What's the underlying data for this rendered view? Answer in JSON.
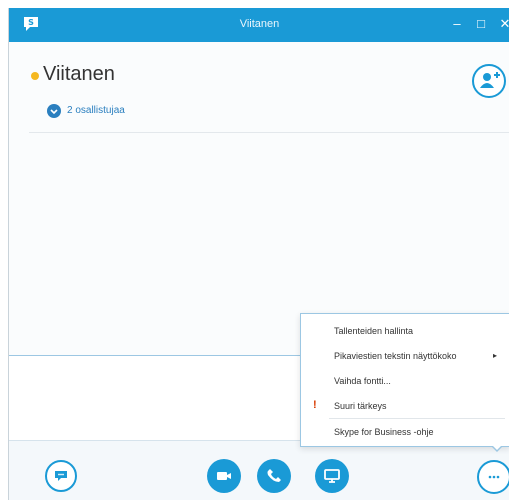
{
  "window": {
    "title": "Viitanen",
    "minimize_glyph": "–",
    "maximize_glyph": "□",
    "close_glyph": "✕"
  },
  "conversation": {
    "name": "Viitanen",
    "presence_color": "#f5b820",
    "participants_label": "2 osallistujaa"
  },
  "menu": {
    "items": [
      {
        "label": "Tallenteiden hallinta"
      },
      {
        "label": "Pikaviestien tekstin näyttökoko",
        "submenu_arrow": "▸"
      },
      {
        "label": "Vaihda fontti..."
      },
      {
        "label": "Suuri tärkeys",
        "icon_glyph": "!"
      },
      {
        "label": "Skype for Business -ohje"
      }
    ]
  },
  "toolbar": {
    "buttons": [
      {
        "icon": "chat-bubble-icon"
      },
      {
        "icon": "video-camera-icon"
      },
      {
        "icon": "phone-icon"
      },
      {
        "icon": "monitor-icon"
      },
      {
        "icon": "more-options-icon"
      }
    ]
  },
  "colors": {
    "accent": "#1a9ad6",
    "title_bar": "#1a9ad6",
    "importance": "#d83b01"
  }
}
